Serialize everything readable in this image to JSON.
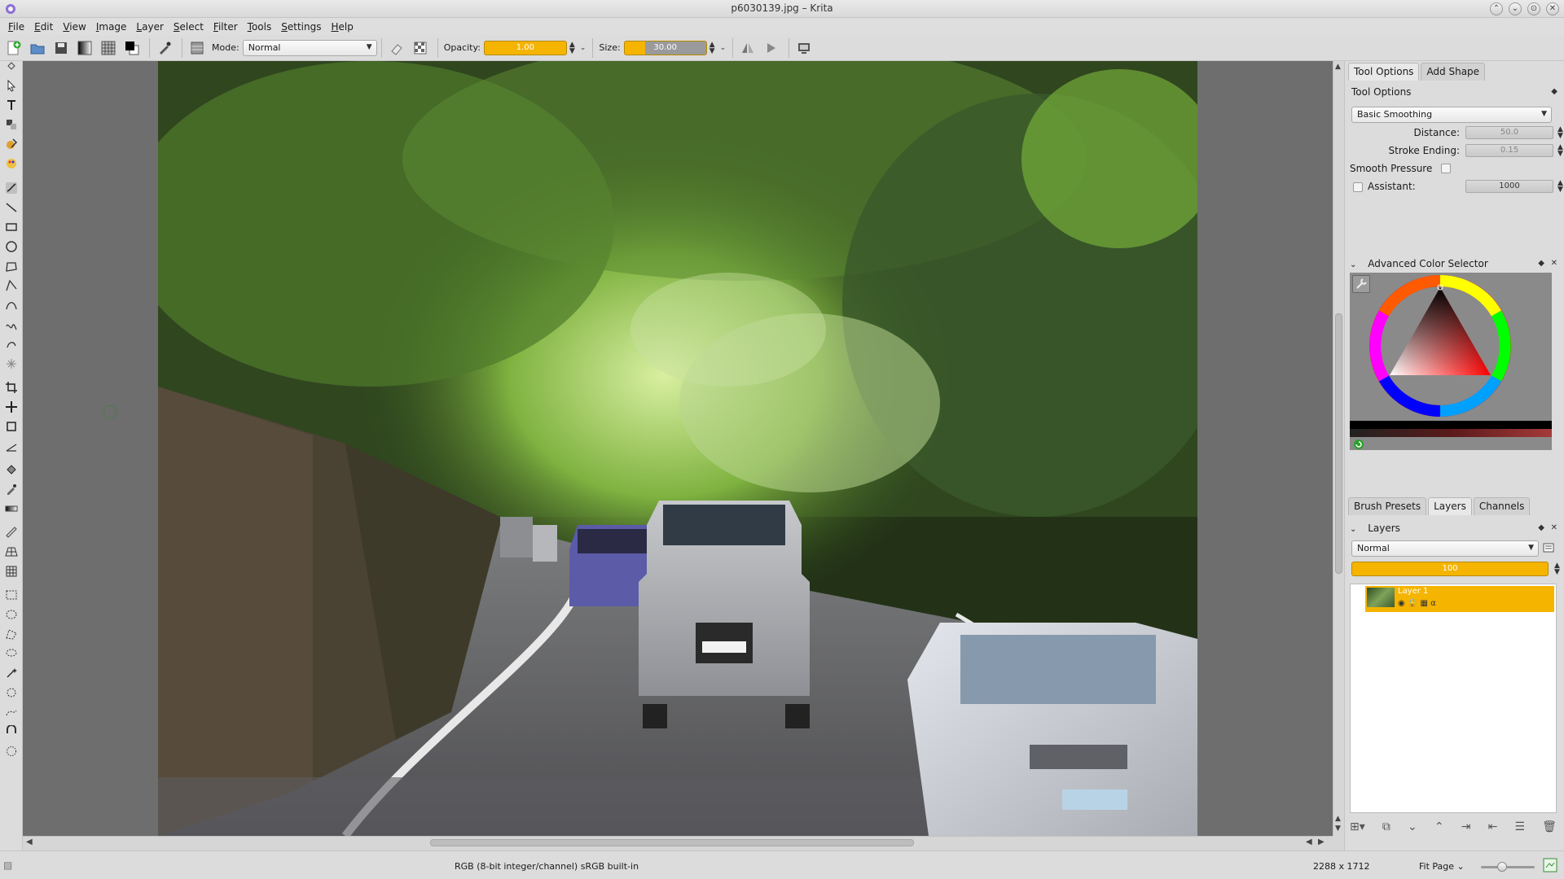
{
  "window": {
    "title": "p6030139.jpg – Krita",
    "buttons": [
      "⌃",
      "⌄",
      "⊙",
      "✕"
    ]
  },
  "menubar": {
    "items": [
      {
        "ul": "F",
        "rest": "ile"
      },
      {
        "ul": "E",
        "rest": "dit"
      },
      {
        "ul": "V",
        "rest": "iew"
      },
      {
        "ul": "I",
        "rest": "mage"
      },
      {
        "ul": "L",
        "rest": "ayer"
      },
      {
        "ul": "S",
        "rest": "elect"
      },
      {
        "ul": "F",
        "rest": "ilter"
      },
      {
        "ul": "T",
        "rest": "ools"
      },
      {
        "ul": "S",
        "rest": "ettings"
      },
      {
        "ul": "H",
        "rest": "elp"
      }
    ]
  },
  "toolbar": {
    "mode_label": "Mode:",
    "mode_value": "Normal",
    "opacity_label": "Opacity:",
    "opacity_value": "1.00",
    "opacity_level": 1.0,
    "size_label": "Size:",
    "size_value": "30.00",
    "size_level": 0.25
  },
  "dock": {
    "tabs_top": [
      "Tool Options",
      "Add Shape"
    ],
    "tool_options": {
      "title": "Tool Options",
      "smoothing": "Basic Smoothing",
      "distance_label": "Distance:",
      "distance_value": "50.0",
      "stroke_ending_label": "Stroke Ending:",
      "stroke_ending_value": "0.15",
      "smooth_pressure_label": "Smooth Pressure",
      "assistant_label": "Assistant:",
      "assistant_value": "1000"
    },
    "color_selector": {
      "title": "Advanced Color Selector"
    },
    "tabs_mid": [
      "Brush Presets",
      "Layers",
      "Channels"
    ],
    "layers": {
      "title": "Layers",
      "blend_mode": "Normal",
      "opacity_value": "100",
      "items": [
        {
          "name": "Layer 1"
        }
      ]
    }
  },
  "status": {
    "color_info": "RGB (8-bit integer/channel)  sRGB built-in",
    "dimensions": "2288 x 1712",
    "zoom": "Fit Page"
  },
  "colors": {
    "accent": "#f5b400",
    "canvas_bg": "#6e6e6e",
    "chrome": "#dcdcdc"
  }
}
